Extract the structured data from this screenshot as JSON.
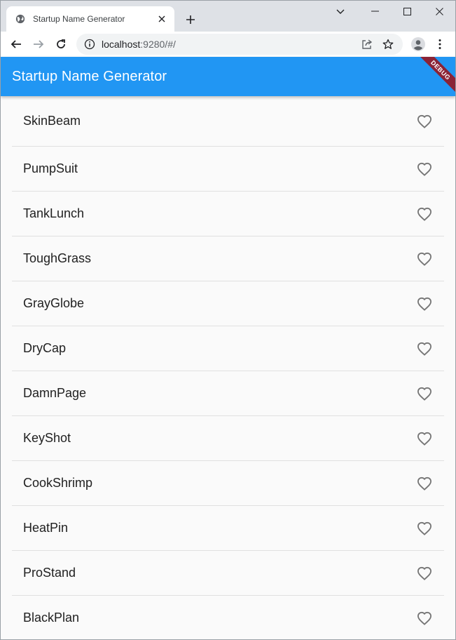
{
  "browser": {
    "tab_title": "Startup Name Generator",
    "url_host": "localhost",
    "url_rest": ":9280/#/"
  },
  "app": {
    "title": "Startup Name Generator",
    "debug_label": "DEBUG",
    "accent_color": "#2196f3"
  },
  "names": [
    {
      "label": "SkinBeam"
    },
    {
      "label": "PumpSuit"
    },
    {
      "label": "TankLunch"
    },
    {
      "label": "ToughGrass"
    },
    {
      "label": "GrayGlobe"
    },
    {
      "label": "DryCap"
    },
    {
      "label": "DamnPage"
    },
    {
      "label": "KeyShot"
    },
    {
      "label": "CookShrimp"
    },
    {
      "label": "HeatPin"
    },
    {
      "label": "ProStand"
    },
    {
      "label": "BlackPlan"
    }
  ]
}
